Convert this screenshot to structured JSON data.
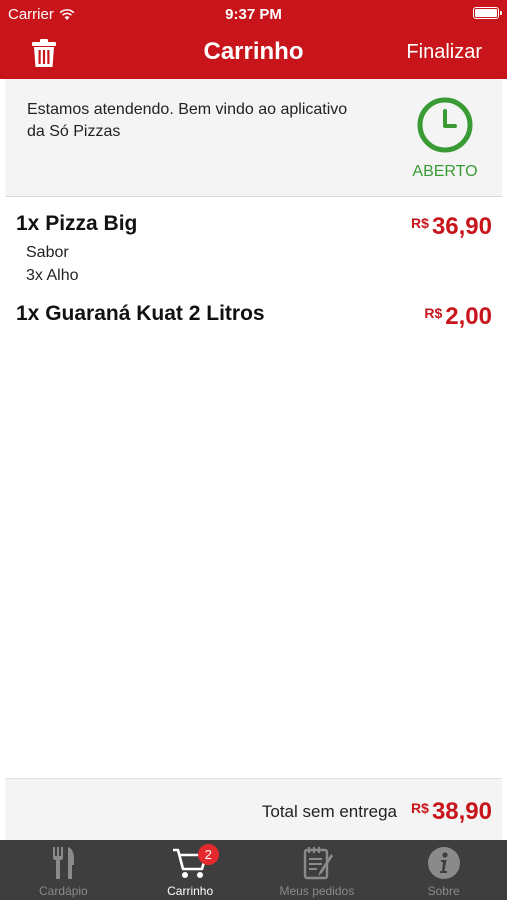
{
  "status_bar": {
    "carrier": "Carrier",
    "time": "9:37 PM"
  },
  "header": {
    "title": "Carrinho",
    "finalize_label": "Finalizar"
  },
  "info": {
    "message_line1": "Estamos atendendo. Bem vindo ao aplicativo",
    "message_line2": "da Só Pizzas",
    "status": "ABERTO"
  },
  "cart": {
    "items": [
      {
        "name": "1x Pizza Big",
        "currency": "R$",
        "price": "36,90",
        "details": [
          "Sabor",
          "3x Alho"
        ]
      },
      {
        "name": "1x Guaraná Kuat 2 Litros",
        "currency": "R$",
        "price": "2,00",
        "details": []
      }
    ]
  },
  "total": {
    "label": "Total sem entrega",
    "currency": "R$",
    "value": "38,90"
  },
  "tabs": [
    {
      "label": "Cardápio",
      "icon": "fork-knife-icon",
      "active": false
    },
    {
      "label": "Carrinho",
      "icon": "cart-icon",
      "active": true,
      "badge": "2"
    },
    {
      "label": "Meus pedidos",
      "icon": "notepad-icon",
      "active": false
    },
    {
      "label": "Sobre",
      "icon": "info-icon",
      "active": false
    }
  ],
  "colors": {
    "brand_red": "#c8151b",
    "open_green": "#3a9b35",
    "tab_bar": "#3e3e3e",
    "badge": "#e52a2f"
  }
}
